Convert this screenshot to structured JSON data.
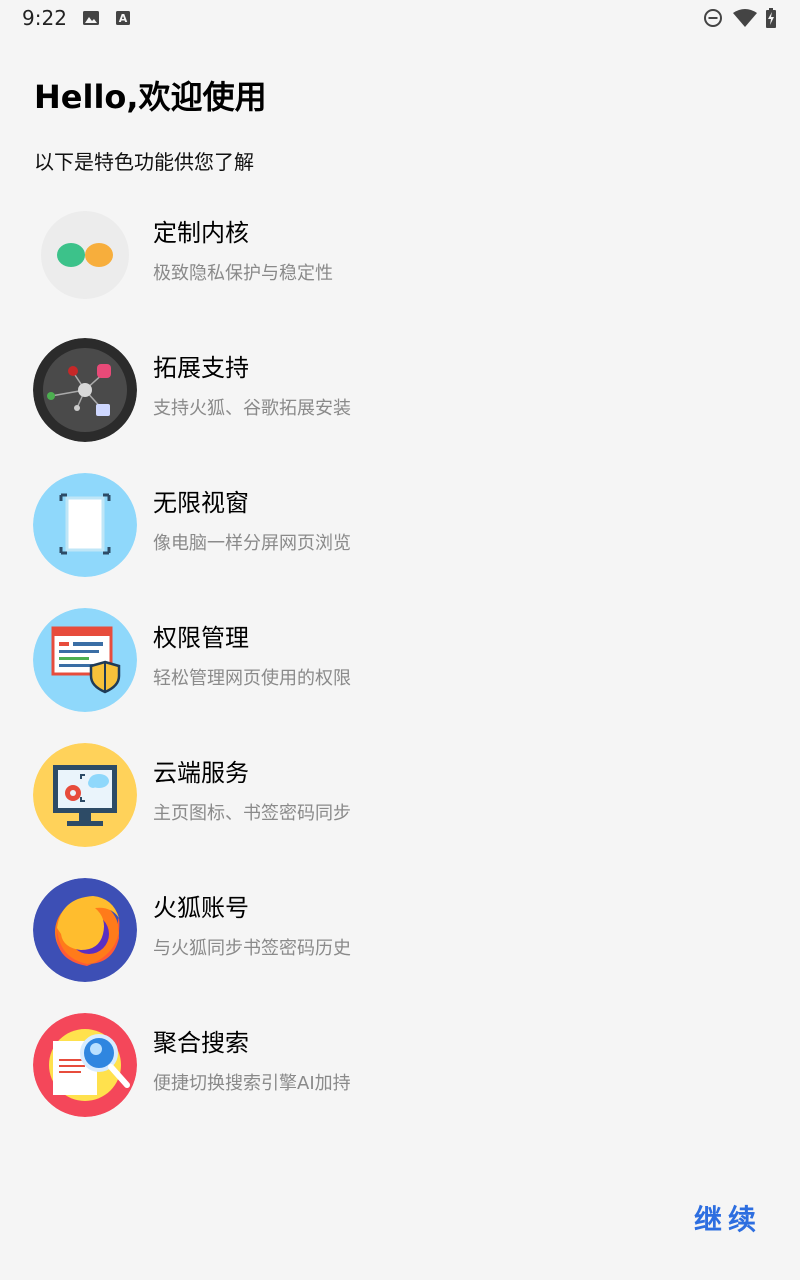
{
  "status_bar": {
    "time": "9:22",
    "left_icons": [
      "image-icon",
      "a-box-icon"
    ],
    "right_icons": [
      "do-not-disturb-icon",
      "wifi-icon",
      "battery-charging-icon"
    ]
  },
  "header": {
    "title": "Hello,欢迎使用",
    "subtitle": "以下是特色功能供您了解"
  },
  "features": [
    {
      "title": "定制内核",
      "desc": "极致隐私保护与稳定性",
      "icon": "custom-kernel-icon"
    },
    {
      "title": "拓展支持",
      "desc": "支持火狐、谷歌拓展安装",
      "icon": "extension-network-icon"
    },
    {
      "title": "无限视窗",
      "desc": "像电脑一样分屏网页浏览",
      "icon": "window-frame-icon"
    },
    {
      "title": "权限管理",
      "desc": "轻松管理网页使用的权限",
      "icon": "permission-shield-icon"
    },
    {
      "title": "云端服务",
      "desc": "主页图标、书签密码同步",
      "icon": "cloud-monitor-icon"
    },
    {
      "title": "火狐账号",
      "desc": "与火狐同步书签密码历史",
      "icon": "firefox-icon"
    },
    {
      "title": "聚合搜索",
      "desc": "便捷切换搜索引擎AI加持",
      "icon": "search-document-icon"
    }
  ],
  "footer": {
    "continue_label": "继续"
  },
  "colors": {
    "accent": "#2d6ee0",
    "background": "#f5f5f5",
    "desc_text": "#8a8a8a"
  }
}
